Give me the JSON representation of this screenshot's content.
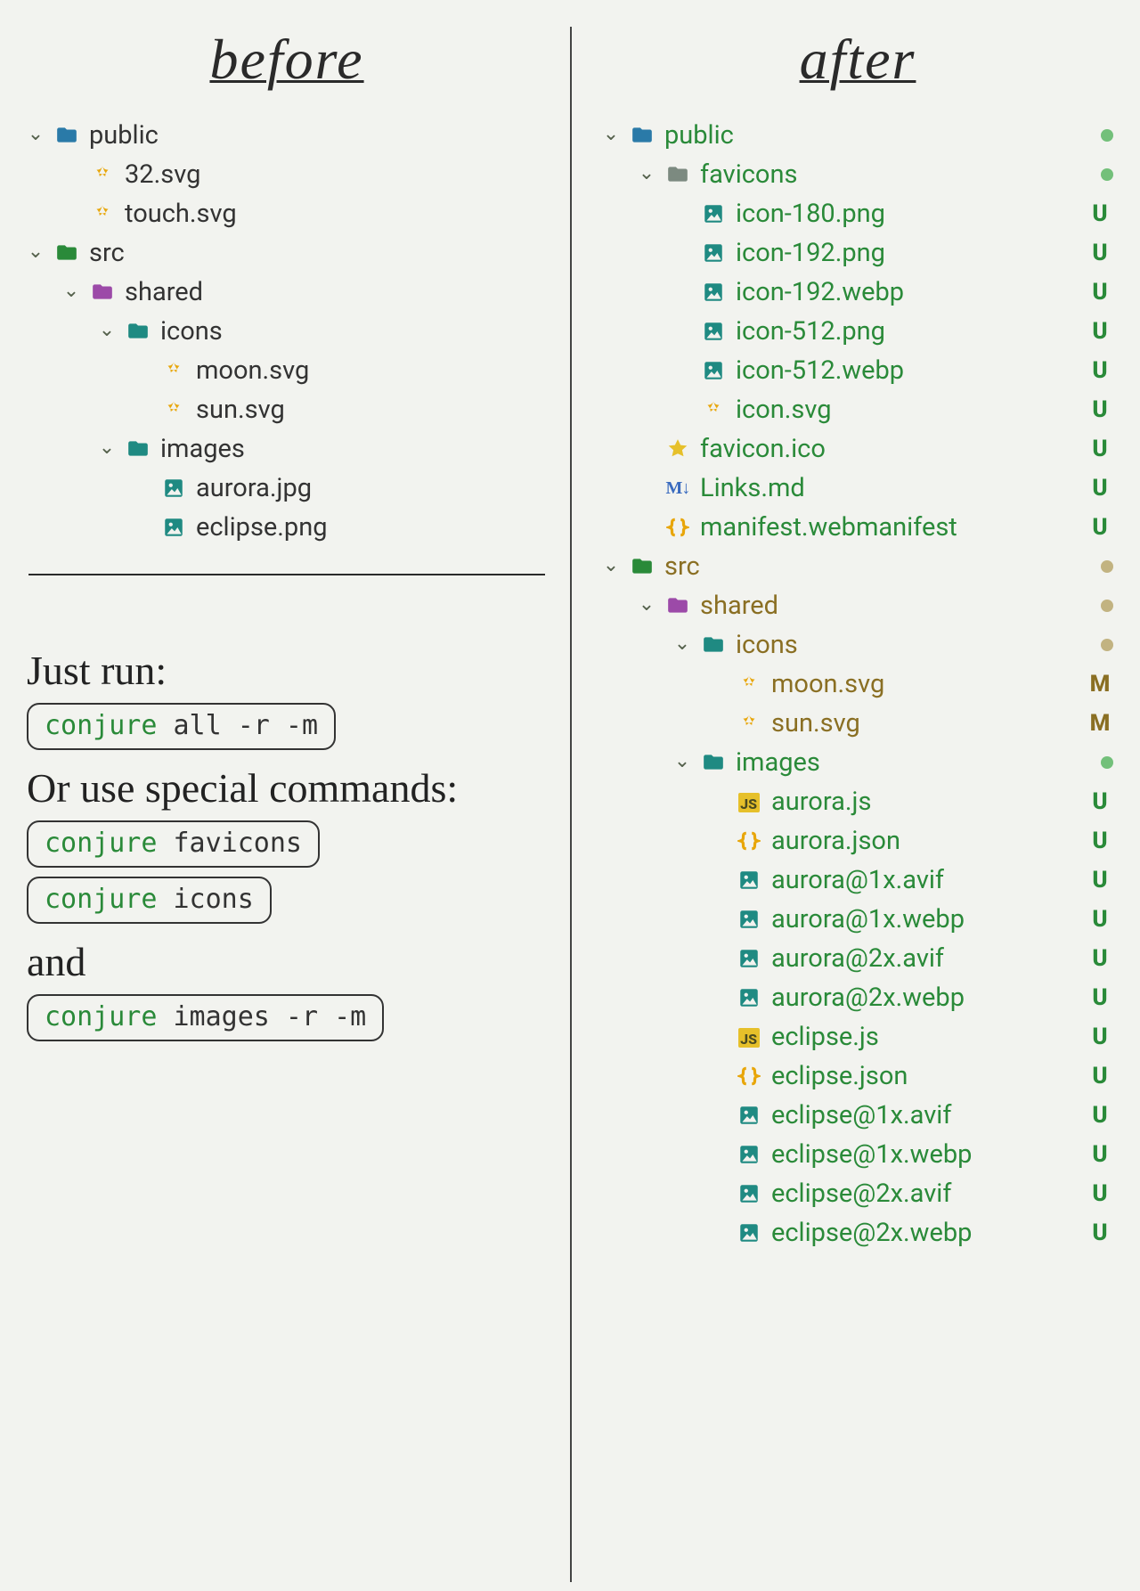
{
  "headings": {
    "before": "before",
    "after": "after"
  },
  "before_tree": [
    {
      "depth": 0,
      "chev": true,
      "icon": "folder-blue",
      "label": "public"
    },
    {
      "depth": 1,
      "chev": false,
      "icon": "svg",
      "label": "32.svg"
    },
    {
      "depth": 1,
      "chev": false,
      "icon": "svg",
      "label": "touch.svg"
    },
    {
      "depth": 0,
      "chev": true,
      "icon": "folder-green",
      "label": "src"
    },
    {
      "depth": 1,
      "chev": true,
      "icon": "folder-purple",
      "label": "shared"
    },
    {
      "depth": 2,
      "chev": true,
      "icon": "folder-teal",
      "label": "icons"
    },
    {
      "depth": 3,
      "chev": false,
      "icon": "svg",
      "label": "moon.svg"
    },
    {
      "depth": 3,
      "chev": false,
      "icon": "svg",
      "label": "sun.svg"
    },
    {
      "depth": 2,
      "chev": true,
      "icon": "folder-teal",
      "label": "images"
    },
    {
      "depth": 3,
      "chev": false,
      "icon": "img",
      "label": "aurora.jpg"
    },
    {
      "depth": 3,
      "chev": false,
      "icon": "img",
      "label": "eclipse.png"
    }
  ],
  "after_tree": [
    {
      "depth": 0,
      "chev": true,
      "icon": "folder-blue",
      "label": "public",
      "txt": "green",
      "status": "dot-g"
    },
    {
      "depth": 1,
      "chev": true,
      "icon": "folder-grey",
      "label": "favicons",
      "txt": "green",
      "status": "dot-g"
    },
    {
      "depth": 2,
      "chev": false,
      "icon": "img",
      "label": "icon-180.png",
      "txt": "green",
      "status": "U"
    },
    {
      "depth": 2,
      "chev": false,
      "icon": "img",
      "label": "icon-192.png",
      "txt": "green",
      "status": "U"
    },
    {
      "depth": 2,
      "chev": false,
      "icon": "img",
      "label": "icon-192.webp",
      "txt": "green",
      "status": "U"
    },
    {
      "depth": 2,
      "chev": false,
      "icon": "img",
      "label": "icon-512.png",
      "txt": "green",
      "status": "U"
    },
    {
      "depth": 2,
      "chev": false,
      "icon": "img",
      "label": "icon-512.webp",
      "txt": "green",
      "status": "U"
    },
    {
      "depth": 2,
      "chev": false,
      "icon": "svg",
      "label": "icon.svg",
      "txt": "green",
      "status": "U"
    },
    {
      "depth": 1,
      "chev": false,
      "icon": "star",
      "label": "favicon.ico",
      "txt": "green",
      "status": "U"
    },
    {
      "depth": 1,
      "chev": false,
      "icon": "md",
      "label": "Links.md",
      "txt": "green",
      "status": "U"
    },
    {
      "depth": 1,
      "chev": false,
      "icon": "json",
      "label": "manifest.webmanifest",
      "txt": "green",
      "status": "U"
    },
    {
      "depth": 0,
      "chev": true,
      "icon": "folder-green",
      "label": "src",
      "txt": "olive",
      "status": "dot-o"
    },
    {
      "depth": 1,
      "chev": true,
      "icon": "folder-purple",
      "label": "shared",
      "txt": "olive",
      "status": "dot-o"
    },
    {
      "depth": 2,
      "chev": true,
      "icon": "folder-teal",
      "label": "icons",
      "txt": "olive",
      "status": "dot-o"
    },
    {
      "depth": 3,
      "chev": false,
      "icon": "svg",
      "label": "moon.svg",
      "txt": "olive",
      "status": "M"
    },
    {
      "depth": 3,
      "chev": false,
      "icon": "svg",
      "label": "sun.svg",
      "txt": "olive",
      "status": "M"
    },
    {
      "depth": 2,
      "chev": true,
      "icon": "folder-teal",
      "label": "images",
      "txt": "green",
      "status": "dot-g"
    },
    {
      "depth": 3,
      "chev": false,
      "icon": "js",
      "label": "aurora.js",
      "txt": "green",
      "status": "U"
    },
    {
      "depth": 3,
      "chev": false,
      "icon": "json",
      "label": "aurora.json",
      "txt": "green",
      "status": "U"
    },
    {
      "depth": 3,
      "chev": false,
      "icon": "img",
      "label": "aurora@1x.avif",
      "txt": "green",
      "status": "U"
    },
    {
      "depth": 3,
      "chev": false,
      "icon": "img",
      "label": "aurora@1x.webp",
      "txt": "green",
      "status": "U"
    },
    {
      "depth": 3,
      "chev": false,
      "icon": "img",
      "label": "aurora@2x.avif",
      "txt": "green",
      "status": "U"
    },
    {
      "depth": 3,
      "chev": false,
      "icon": "img",
      "label": "aurora@2x.webp",
      "txt": "green",
      "status": "U"
    },
    {
      "depth": 3,
      "chev": false,
      "icon": "js",
      "label": "eclipse.js",
      "txt": "green",
      "status": "U"
    },
    {
      "depth": 3,
      "chev": false,
      "icon": "json",
      "label": "eclipse.json",
      "txt": "green",
      "status": "U"
    },
    {
      "depth": 3,
      "chev": false,
      "icon": "img",
      "label": "eclipse@1x.avif",
      "txt": "green",
      "status": "U"
    },
    {
      "depth": 3,
      "chev": false,
      "icon": "img",
      "label": "eclipse@1x.webp",
      "txt": "green",
      "status": "U"
    },
    {
      "depth": 3,
      "chev": false,
      "icon": "img",
      "label": "eclipse@2x.avif",
      "txt": "green",
      "status": "U"
    },
    {
      "depth": 3,
      "chev": false,
      "icon": "img",
      "label": "eclipse@2x.webp",
      "txt": "green",
      "status": "U"
    }
  ],
  "notes": {
    "l1": "Just run:",
    "l2": "Or use special commands:",
    "l3": "and"
  },
  "commands": {
    "c1": {
      "kw": "conjure",
      "rest": " all -r -m"
    },
    "c2": {
      "kw": "conjure",
      "rest": " favicons"
    },
    "c3": {
      "kw": "conjure",
      "rest": " icons"
    },
    "c4": {
      "kw": "conjure",
      "rest": " images -r -m"
    }
  }
}
